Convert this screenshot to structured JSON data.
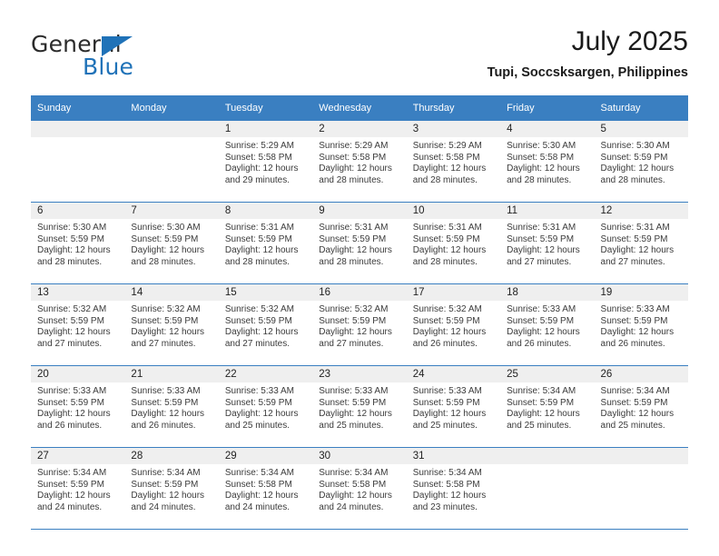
{
  "brand": {
    "name_top": "General",
    "name_bottom": "Blue",
    "accent_color": "#1f72b8"
  },
  "header": {
    "title": "July 2025",
    "subtitle": "Tupi, Soccsksargen, Philippines"
  },
  "theme": {
    "header_row_color": "#3a7fc1",
    "daynum_band_color": "#efefef",
    "text_color": "#3b3b3b"
  },
  "weekday_headers": [
    "Sunday",
    "Monday",
    "Tuesday",
    "Wednesday",
    "Thursday",
    "Friday",
    "Saturday"
  ],
  "weeks": [
    [
      {
        "day": "",
        "sunrise": "",
        "sunset": "",
        "daylight_line1": "",
        "daylight_line2": ""
      },
      {
        "day": "",
        "sunrise": "",
        "sunset": "",
        "daylight_line1": "",
        "daylight_line2": ""
      },
      {
        "day": "1",
        "sunrise": "Sunrise: 5:29 AM",
        "sunset": "Sunset: 5:58 PM",
        "daylight_line1": "Daylight: 12 hours",
        "daylight_line2": "and 29 minutes."
      },
      {
        "day": "2",
        "sunrise": "Sunrise: 5:29 AM",
        "sunset": "Sunset: 5:58 PM",
        "daylight_line1": "Daylight: 12 hours",
        "daylight_line2": "and 28 minutes."
      },
      {
        "day": "3",
        "sunrise": "Sunrise: 5:29 AM",
        "sunset": "Sunset: 5:58 PM",
        "daylight_line1": "Daylight: 12 hours",
        "daylight_line2": "and 28 minutes."
      },
      {
        "day": "4",
        "sunrise": "Sunrise: 5:30 AM",
        "sunset": "Sunset: 5:58 PM",
        "daylight_line1": "Daylight: 12 hours",
        "daylight_line2": "and 28 minutes."
      },
      {
        "day": "5",
        "sunrise": "Sunrise: 5:30 AM",
        "sunset": "Sunset: 5:59 PM",
        "daylight_line1": "Daylight: 12 hours",
        "daylight_line2": "and 28 minutes."
      }
    ],
    [
      {
        "day": "6",
        "sunrise": "Sunrise: 5:30 AM",
        "sunset": "Sunset: 5:59 PM",
        "daylight_line1": "Daylight: 12 hours",
        "daylight_line2": "and 28 minutes."
      },
      {
        "day": "7",
        "sunrise": "Sunrise: 5:30 AM",
        "sunset": "Sunset: 5:59 PM",
        "daylight_line1": "Daylight: 12 hours",
        "daylight_line2": "and 28 minutes."
      },
      {
        "day": "8",
        "sunrise": "Sunrise: 5:31 AM",
        "sunset": "Sunset: 5:59 PM",
        "daylight_line1": "Daylight: 12 hours",
        "daylight_line2": "and 28 minutes."
      },
      {
        "day": "9",
        "sunrise": "Sunrise: 5:31 AM",
        "sunset": "Sunset: 5:59 PM",
        "daylight_line1": "Daylight: 12 hours",
        "daylight_line2": "and 28 minutes."
      },
      {
        "day": "10",
        "sunrise": "Sunrise: 5:31 AM",
        "sunset": "Sunset: 5:59 PM",
        "daylight_line1": "Daylight: 12 hours",
        "daylight_line2": "and 28 minutes."
      },
      {
        "day": "11",
        "sunrise": "Sunrise: 5:31 AM",
        "sunset": "Sunset: 5:59 PM",
        "daylight_line1": "Daylight: 12 hours",
        "daylight_line2": "and 27 minutes."
      },
      {
        "day": "12",
        "sunrise": "Sunrise: 5:31 AM",
        "sunset": "Sunset: 5:59 PM",
        "daylight_line1": "Daylight: 12 hours",
        "daylight_line2": "and 27 minutes."
      }
    ],
    [
      {
        "day": "13",
        "sunrise": "Sunrise: 5:32 AM",
        "sunset": "Sunset: 5:59 PM",
        "daylight_line1": "Daylight: 12 hours",
        "daylight_line2": "and 27 minutes."
      },
      {
        "day": "14",
        "sunrise": "Sunrise: 5:32 AM",
        "sunset": "Sunset: 5:59 PM",
        "daylight_line1": "Daylight: 12 hours",
        "daylight_line2": "and 27 minutes."
      },
      {
        "day": "15",
        "sunrise": "Sunrise: 5:32 AM",
        "sunset": "Sunset: 5:59 PM",
        "daylight_line1": "Daylight: 12 hours",
        "daylight_line2": "and 27 minutes."
      },
      {
        "day": "16",
        "sunrise": "Sunrise: 5:32 AM",
        "sunset": "Sunset: 5:59 PM",
        "daylight_line1": "Daylight: 12 hours",
        "daylight_line2": "and 27 minutes."
      },
      {
        "day": "17",
        "sunrise": "Sunrise: 5:32 AM",
        "sunset": "Sunset: 5:59 PM",
        "daylight_line1": "Daylight: 12 hours",
        "daylight_line2": "and 26 minutes."
      },
      {
        "day": "18",
        "sunrise": "Sunrise: 5:33 AM",
        "sunset": "Sunset: 5:59 PM",
        "daylight_line1": "Daylight: 12 hours",
        "daylight_line2": "and 26 minutes."
      },
      {
        "day": "19",
        "sunrise": "Sunrise: 5:33 AM",
        "sunset": "Sunset: 5:59 PM",
        "daylight_line1": "Daylight: 12 hours",
        "daylight_line2": "and 26 minutes."
      }
    ],
    [
      {
        "day": "20",
        "sunrise": "Sunrise: 5:33 AM",
        "sunset": "Sunset: 5:59 PM",
        "daylight_line1": "Daylight: 12 hours",
        "daylight_line2": "and 26 minutes."
      },
      {
        "day": "21",
        "sunrise": "Sunrise: 5:33 AM",
        "sunset": "Sunset: 5:59 PM",
        "daylight_line1": "Daylight: 12 hours",
        "daylight_line2": "and 26 minutes."
      },
      {
        "day": "22",
        "sunrise": "Sunrise: 5:33 AM",
        "sunset": "Sunset: 5:59 PM",
        "daylight_line1": "Daylight: 12 hours",
        "daylight_line2": "and 25 minutes."
      },
      {
        "day": "23",
        "sunrise": "Sunrise: 5:33 AM",
        "sunset": "Sunset: 5:59 PM",
        "daylight_line1": "Daylight: 12 hours",
        "daylight_line2": "and 25 minutes."
      },
      {
        "day": "24",
        "sunrise": "Sunrise: 5:33 AM",
        "sunset": "Sunset: 5:59 PM",
        "daylight_line1": "Daylight: 12 hours",
        "daylight_line2": "and 25 minutes."
      },
      {
        "day": "25",
        "sunrise": "Sunrise: 5:34 AM",
        "sunset": "Sunset: 5:59 PM",
        "daylight_line1": "Daylight: 12 hours",
        "daylight_line2": "and 25 minutes."
      },
      {
        "day": "26",
        "sunrise": "Sunrise: 5:34 AM",
        "sunset": "Sunset: 5:59 PM",
        "daylight_line1": "Daylight: 12 hours",
        "daylight_line2": "and 25 minutes."
      }
    ],
    [
      {
        "day": "27",
        "sunrise": "Sunrise: 5:34 AM",
        "sunset": "Sunset: 5:59 PM",
        "daylight_line1": "Daylight: 12 hours",
        "daylight_line2": "and 24 minutes."
      },
      {
        "day": "28",
        "sunrise": "Sunrise: 5:34 AM",
        "sunset": "Sunset: 5:59 PM",
        "daylight_line1": "Daylight: 12 hours",
        "daylight_line2": "and 24 minutes."
      },
      {
        "day": "29",
        "sunrise": "Sunrise: 5:34 AM",
        "sunset": "Sunset: 5:58 PM",
        "daylight_line1": "Daylight: 12 hours",
        "daylight_line2": "and 24 minutes."
      },
      {
        "day": "30",
        "sunrise": "Sunrise: 5:34 AM",
        "sunset": "Sunset: 5:58 PM",
        "daylight_line1": "Daylight: 12 hours",
        "daylight_line2": "and 24 minutes."
      },
      {
        "day": "31",
        "sunrise": "Sunrise: 5:34 AM",
        "sunset": "Sunset: 5:58 PM",
        "daylight_line1": "Daylight: 12 hours",
        "daylight_line2": "and 23 minutes."
      },
      {
        "day": "",
        "sunrise": "",
        "sunset": "",
        "daylight_line1": "",
        "daylight_line2": ""
      },
      {
        "day": "",
        "sunrise": "",
        "sunset": "",
        "daylight_line1": "",
        "daylight_line2": ""
      }
    ]
  ]
}
